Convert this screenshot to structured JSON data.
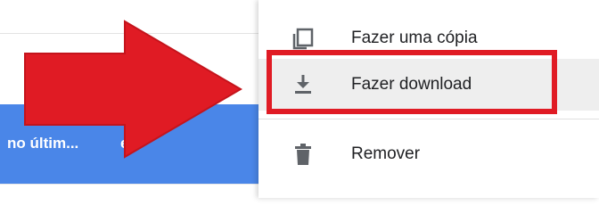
{
  "list": {
    "selected_row": {
      "col1": "no últim...",
      "col2": "e"
    }
  },
  "menu": {
    "items": [
      {
        "label": "Fazer uma cópia",
        "icon": "copy-icon"
      },
      {
        "label": "Fazer download",
        "icon": "download-icon"
      },
      {
        "label": "Remover",
        "icon": "trash-icon"
      }
    ],
    "highlighted_index": 1
  },
  "annotation": {
    "arrow_color": "#e01b24",
    "box_color": "#e01b24"
  },
  "colors": {
    "selection": "#4a86e8",
    "hover": "#eeeeee",
    "icon": "#5f6368"
  }
}
